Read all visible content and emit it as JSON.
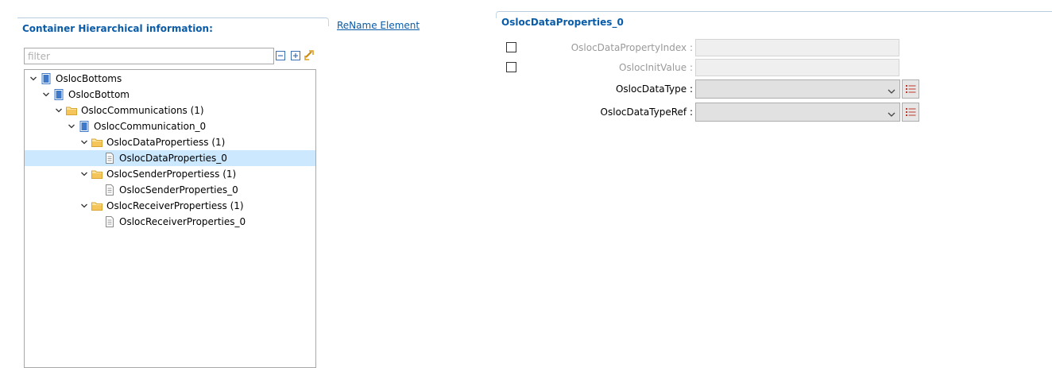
{
  "hierarchy": {
    "title": "Container Hierarchical information:",
    "rename_link": "ReName Element",
    "filter_placeholder": "filter",
    "toolbar": [
      "collapse-all-icon",
      "expand-all-icon",
      "link-sync-icon"
    ],
    "tree": [
      {
        "label": "OslocBottoms",
        "icon": "container-book-icon",
        "expanded": true
      },
      {
        "label": "OslocBottom",
        "icon": "container-book-icon",
        "expanded": true
      },
      {
        "label": "OslocCommunications (1)",
        "icon": "folder-icon",
        "expanded": true
      },
      {
        "label": "OslocCommunication_0",
        "icon": "container-book-icon",
        "expanded": true
      },
      {
        "label": "OslocDataPropertiess (1)",
        "icon": "folder-icon",
        "expanded": true
      },
      {
        "label": "OslocDataProperties_0",
        "icon": "document-icon",
        "selected": true
      },
      {
        "label": "OslocSenderPropertiess (1)",
        "icon": "folder-icon",
        "expanded": true
      },
      {
        "label": "OslocSenderProperties_0",
        "icon": "document-icon"
      },
      {
        "label": "OslocReceiverPropertiess (1)",
        "icon": "folder-icon",
        "expanded": true
      },
      {
        "label": "OslocReceiverProperties_0",
        "icon": "document-icon"
      }
    ]
  },
  "properties": {
    "title": "OslocDataProperties_0",
    "fields": [
      {
        "label": "OslocDataPropertyIndex :",
        "value": "",
        "enabled": false,
        "checkbox": true,
        "checked": false
      },
      {
        "label": "OslocInitValue :",
        "value": "",
        "enabled": false,
        "checkbox": true,
        "checked": false
      },
      {
        "label": "OslocDataType :",
        "value": "",
        "enabled": true,
        "type": "select"
      },
      {
        "label": "OslocDataTypeRef :",
        "value": "",
        "enabled": true,
        "type": "select"
      }
    ]
  },
  "colors": {
    "accent": "#0a5ca8",
    "selection": "#cce8ff",
    "folder": "#f5c55a",
    "book": "#3f78c6",
    "list_icon": "#c0392b"
  }
}
